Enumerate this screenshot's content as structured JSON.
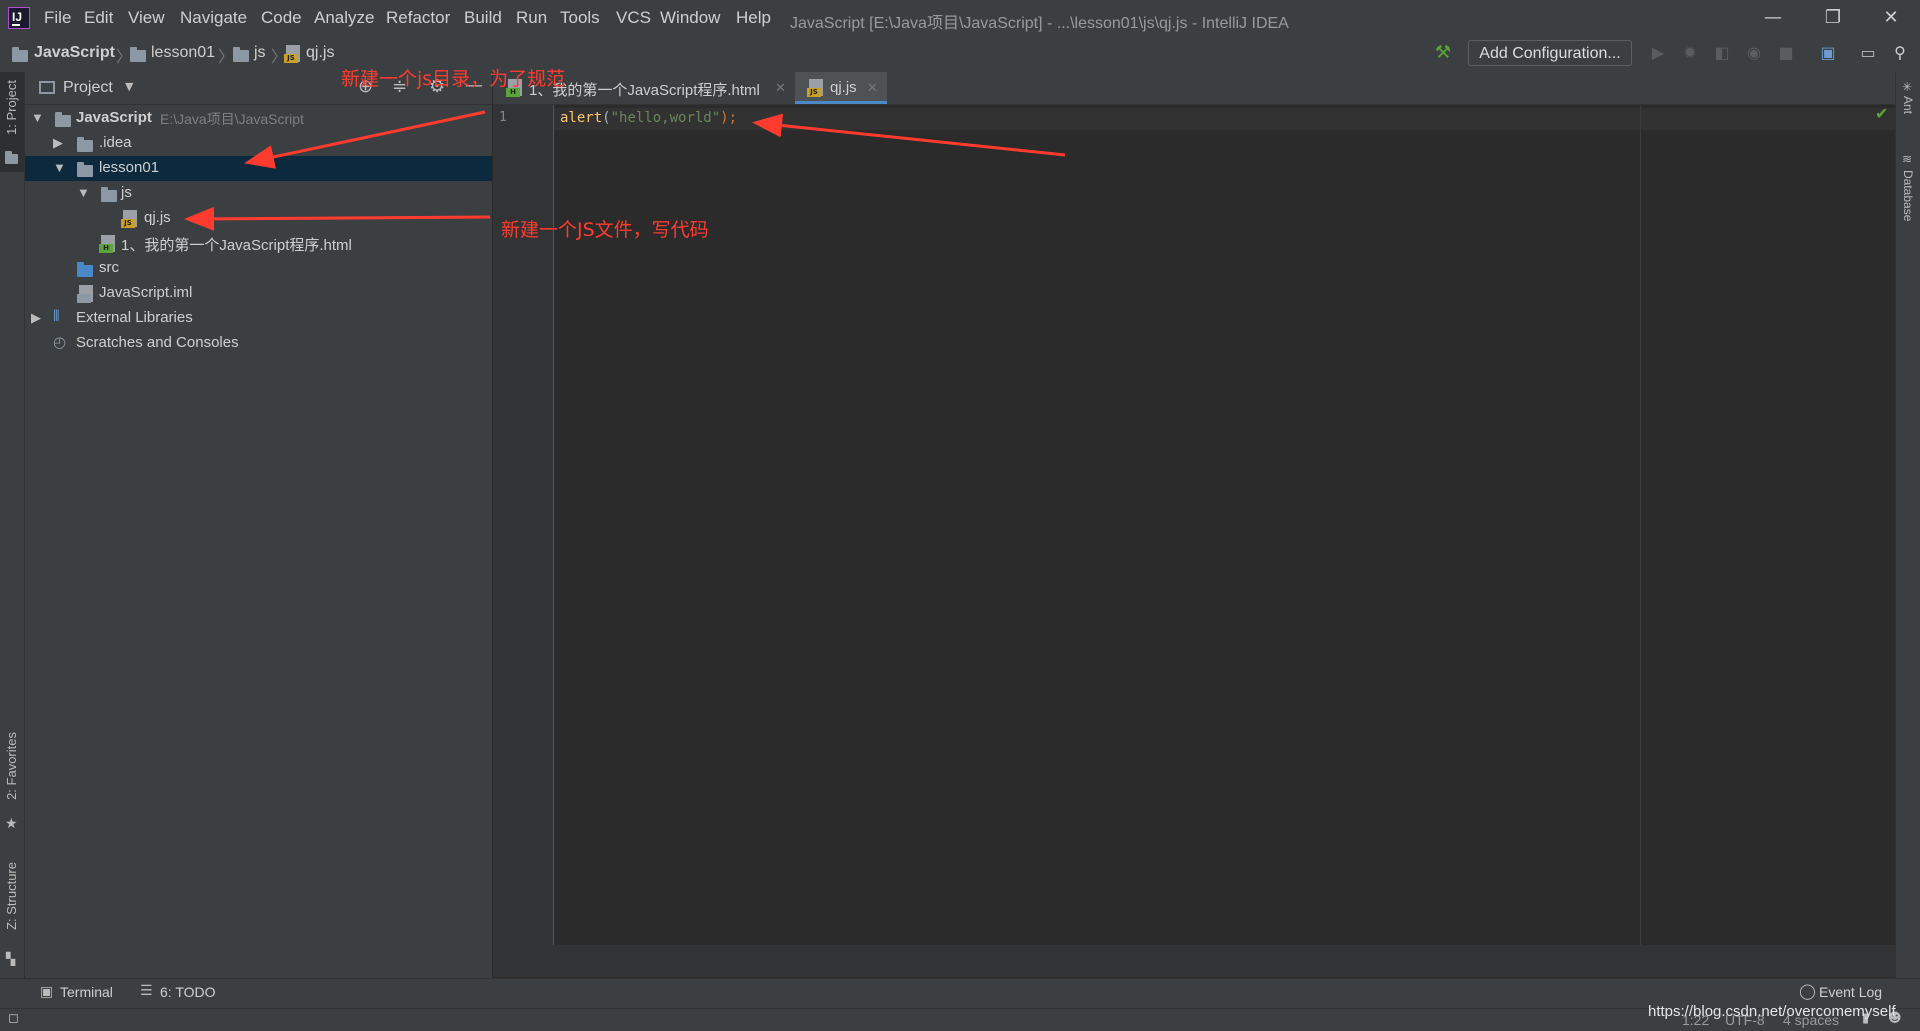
{
  "titlebar": {
    "menu": [
      "File",
      "Edit",
      "View",
      "Navigate",
      "Code",
      "Analyze",
      "Refactor",
      "Build",
      "Run",
      "Tools",
      "VCS",
      "Window",
      "Help"
    ],
    "window_title": "JavaScript [E:\\Java项目\\JavaScript] - ...\\lesson01\\js\\qj.js - IntelliJ IDEA",
    "minimize": "—",
    "restore": "❐",
    "close": "✕"
  },
  "navbar": {
    "breadcrumbs": [
      "JavaScript",
      "lesson01",
      "js",
      "qj.js"
    ],
    "add_configuration": "Add Configuration..."
  },
  "left_strip": {
    "project": "1: Project",
    "favorites": "2: Favorites",
    "structure": "Z: Structure"
  },
  "right_strip": {
    "ant": "Ant",
    "database": "Database"
  },
  "project_panel": {
    "title": "Project",
    "tree": [
      {
        "label": "JavaScript",
        "hint": "E:\\Java项目\\JavaScript"
      },
      {
        "label": ".idea"
      },
      {
        "label": "lesson01"
      },
      {
        "label": "js"
      },
      {
        "label": "qj.js"
      },
      {
        "label": "1、我的第一个JavaScript程序.html"
      },
      {
        "label": "src"
      },
      {
        "label": "JavaScript.iml"
      },
      {
        "label": "External Libraries"
      },
      {
        "label": "Scratches and Consoles"
      }
    ]
  },
  "editor": {
    "tabs": [
      {
        "label": "1、我的第一个JavaScript程序.html"
      },
      {
        "label": "qj.js"
      }
    ],
    "line_number": "1",
    "code": {
      "fn": "alert",
      "open": "(",
      "str": "\"hello,world\"",
      "close": ");"
    }
  },
  "bottom_bar": {
    "terminal": "Terminal",
    "todo": "6: TODO",
    "event_log": "Event Log"
  },
  "status_bar": {
    "position": "1:22",
    "encoding": "UTF-8",
    "indent": "4 spaces",
    "watermark": "https://blog.csdn.net/overcomemyself"
  },
  "annotations": {
    "note1": "新建一个js目录，为了规范",
    "note2": "新建一个JS文件，写代码"
  },
  "colors": {
    "keyword_fn": "#ffc66d",
    "string": "#6a8759",
    "annotation": "#ff3b30",
    "selection": "#0d293e"
  }
}
